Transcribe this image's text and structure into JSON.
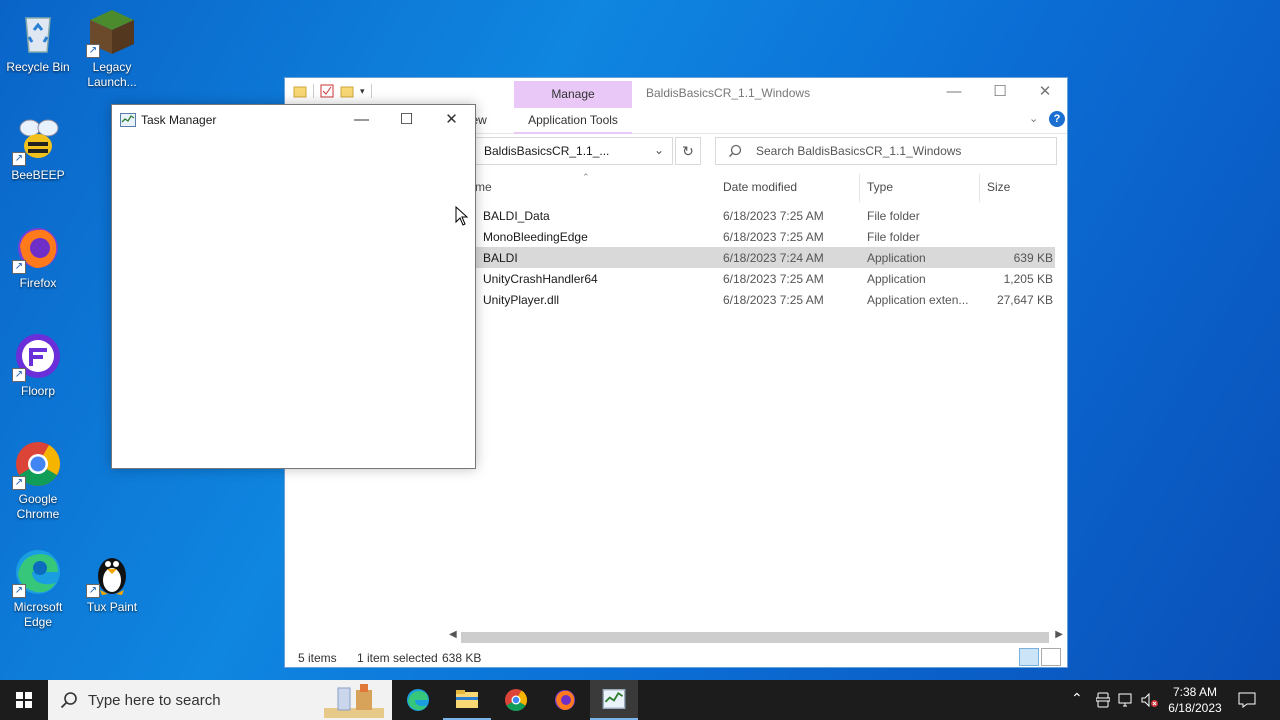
{
  "desktop": {
    "icons": [
      {
        "label": "Recycle Bin"
      },
      {
        "label": "Legacy Launch..."
      },
      {
        "label": "BeeBEEP"
      },
      {
        "label": "Firefox"
      },
      {
        "label": "Floorp"
      },
      {
        "label": "Google Chrome"
      },
      {
        "label": "Microsoft Edge"
      },
      {
        "label": "Tux Paint"
      }
    ]
  },
  "explorer": {
    "title": "BaldisBasicsCR_1.1_Windows",
    "manage_tab": "Manage",
    "view_tab": "View",
    "app_tools_tab": "Application Tools",
    "address": "BaldisBasicsCR_1.1_...",
    "search_placeholder": "Search BaldisBasicsCR_1.1_Windows",
    "columns": {
      "name": "me",
      "date": "Date modified",
      "type": "Type",
      "size": "Size"
    },
    "files": [
      {
        "name": "BALDI_Data",
        "date": "6/18/2023 7:25 AM",
        "type": "File folder",
        "size": ""
      },
      {
        "name": "MonoBleedingEdge",
        "date": "6/18/2023 7:25 AM",
        "type": "File folder",
        "size": ""
      },
      {
        "name": "BALDI",
        "date": "6/18/2023 7:24 AM",
        "type": "Application",
        "size": "639 KB"
      },
      {
        "name": "UnityCrashHandler64",
        "date": "6/18/2023 7:25 AM",
        "type": "Application",
        "size": "1,205 KB"
      },
      {
        "name": "UnityPlayer.dll",
        "date": "6/18/2023 7:25 AM",
        "type": "Application exten...",
        "size": "27,647 KB"
      }
    ],
    "status": {
      "count": "5 items",
      "selected": "1 item selected",
      "selected_size": "638 KB"
    }
  },
  "taskmgr": {
    "title": "Task Manager"
  },
  "taskbar": {
    "search_placeholder": "Type here to search",
    "time": "7:38 AM",
    "date": "6/18/2023"
  },
  "colors": {
    "desktop": "#0a74d6",
    "manage_tab": "#e9c8f7",
    "selection": "#d9d9d9",
    "taskbar": "#1c1c1c"
  }
}
